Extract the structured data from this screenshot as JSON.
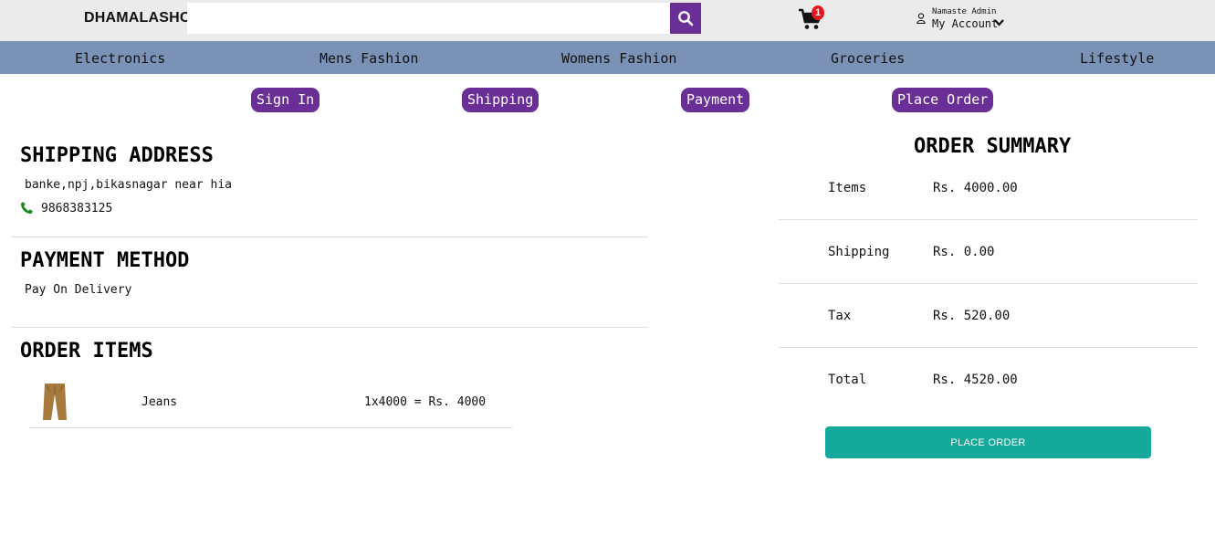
{
  "header": {
    "brand": "DHAMALASHOP",
    "search": {
      "placeholder": "",
      "value": ""
    },
    "cart_count": "1",
    "account": {
      "greeting": "Namaste Admin",
      "label": "My Account"
    }
  },
  "categories": [
    "Electronics",
    "Mens Fashion",
    "Womens Fashion",
    "Groceries",
    "Lifestyle"
  ],
  "steps": [
    "Sign In",
    "Shipping",
    "Payment",
    "Place Order"
  ],
  "shipping": {
    "title": "SHIPPING ADDRESS",
    "address": "banke,npj,bikasnagar near hia",
    "phone": "9868383125"
  },
  "payment": {
    "title": "PAYMENT METHOD",
    "method": "Pay On Delivery"
  },
  "order_items": {
    "title": "ORDER ITEMS",
    "items": [
      {
        "name": "Jeans",
        "price_line": "1x4000 = Rs. 4000"
      }
    ]
  },
  "summary": {
    "title": "ORDER SUMMARY",
    "rows": [
      {
        "label": "Items",
        "value": "Rs. 4000.00"
      },
      {
        "label": "Shipping",
        "value": "Rs. 0.00"
      },
      {
        "label": "Tax",
        "value": "Rs. 520.00"
      },
      {
        "label": "Total",
        "value": "Rs. 4520.00"
      }
    ],
    "button": "PLACE ORDER"
  },
  "colors": {
    "header_bg": "#ebebeb",
    "nav_bg": "#7a92b6",
    "accent_purple": "#6a2f96",
    "place_order": "#15a99b",
    "badge": "#e8141b",
    "phone_icon": "#1a8a1a"
  }
}
